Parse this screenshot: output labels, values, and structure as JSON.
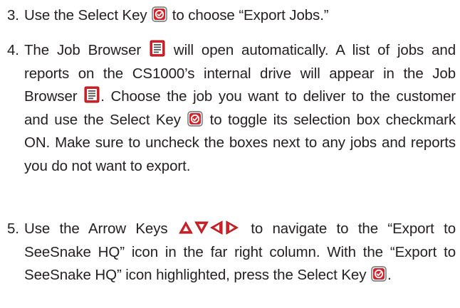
{
  "steps": [
    {
      "number": "3.",
      "segments": [
        {
          "text": "Use the Select Key "
        },
        {
          "icon": "select-key-icon"
        },
        {
          "text": " to choose “Export Jobs.”"
        }
      ]
    },
    {
      "number": "4.",
      "segments": [
        {
          "text": "The Job Browser "
        },
        {
          "icon": "job-browser-icon"
        },
        {
          "text": " will open automatically. A list of jobs and reports on the CS1000’s internal drive will ap­pear in the Job Browser "
        },
        {
          "icon": "job-browser-icon"
        },
        {
          "text": ". Choose the job you want to deliver to the customer and use the Select Key "
        },
        {
          "icon": "select-key-icon"
        },
        {
          "text": " to toggle its selection box checkmark ON. Make sure to uncheck the boxes next to any jobs and reports you do not want to export."
        }
      ]
    },
    {
      "number": "5.",
      "segments": [
        {
          "text": "Use the Arrow Keys "
        },
        {
          "icon": "arrow-keys-icon"
        },
        {
          "text": " to navigate to the “Ex­port to SeeSnake HQ” icon in the far right column. With the “Export to SeeSnake HQ” icon highlighted, press the Select Key "
        },
        {
          "icon": "select-key-icon"
        },
        {
          "text": "."
        }
      ]
    }
  ],
  "colors": {
    "text": "#231f20",
    "icon_red": "#d2232a",
    "icon_red_dark": "#a4151b"
  }
}
